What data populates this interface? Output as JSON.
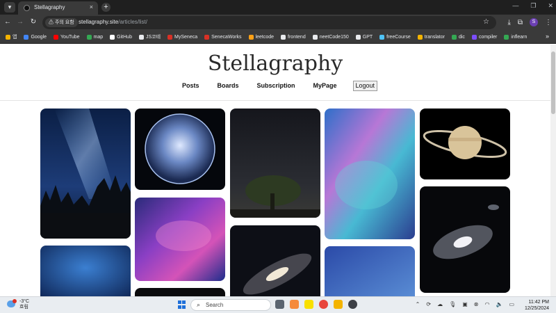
{
  "browser": {
    "tab_title": "Stellagraphy",
    "tab_close": "×",
    "new_tab": "+",
    "security_chip": "주의 요함",
    "url_host": "stellagraphy.site",
    "url_path": "/articles/list/",
    "profile_initial": "S",
    "bookmarks": [
      {
        "label": "앱",
        "icon": "apps-grid-icon",
        "color": "#f4b400"
      },
      {
        "label": "Google",
        "icon": "google-icon",
        "color": "#4285f4"
      },
      {
        "label": "YouTube",
        "icon": "youtube-icon",
        "color": "#ff0000"
      },
      {
        "label": "map",
        "icon": "map-icon",
        "color": "#34a853"
      },
      {
        "label": "GitHub",
        "icon": "github-icon",
        "color": "#ffffff"
      },
      {
        "label": "JS코테",
        "icon": "triangle-icon",
        "color": "#e8eaed"
      },
      {
        "label": "MySeneca",
        "icon": "seneca-icon",
        "color": "#d93025"
      },
      {
        "label": "SenecaWorks",
        "icon": "seneca-works-icon",
        "color": "#d93025"
      },
      {
        "label": "leetcode",
        "icon": "leetcode-icon",
        "color": "#ffa116"
      },
      {
        "label": "frontend",
        "icon": "code-icon",
        "color": "#e8eaed"
      },
      {
        "label": "neetCode150",
        "icon": "rocket-icon",
        "color": "#e8eaed"
      },
      {
        "label": "GPT",
        "icon": "openai-icon",
        "color": "#e8eaed"
      },
      {
        "label": "freeCourse",
        "icon": "course-icon",
        "color": "#4fc3f7"
      },
      {
        "label": "translator",
        "icon": "folder-icon",
        "color": "#f4b400"
      },
      {
        "label": "dic",
        "icon": "folder-icon",
        "color": "#34a853"
      },
      {
        "label": "compiler",
        "icon": "bolt-icon",
        "color": "#7c4dff"
      },
      {
        "label": "inflearn",
        "icon": "inflearn-icon",
        "color": "#34a853"
      }
    ]
  },
  "site": {
    "title": "Stellagraphy",
    "nav": {
      "posts": "Posts",
      "boards": "Boards",
      "subscription": "Subscription",
      "mypage": "MyPage",
      "logout": "Logout"
    }
  },
  "gallery": [
    {
      "name": "milky-way-forest-photo",
      "image": "Milky Way over pine forest silhouette"
    },
    {
      "name": "crystal-star-sphere-photo",
      "image": "Glowing crystal sphere of stars"
    },
    {
      "name": "colorful-nebula-photo",
      "image": "Purple and blue nebula"
    },
    {
      "name": "night-tree-starry-sky-photo",
      "image": "Tree under starry night sky"
    },
    {
      "name": "andromeda-galaxy-photo",
      "image": "Andromeda galaxy"
    },
    {
      "name": "cosmic-cloud-nebula-photo",
      "image": "Cyan and pink cosmic clouds"
    },
    {
      "name": "blue-star-field-photo",
      "image": "Blue star field"
    },
    {
      "name": "saturn-planet-photo",
      "image": "Saturn with rings"
    },
    {
      "name": "spiral-galaxy-photo",
      "image": "Spiral galaxy with stars"
    }
  ],
  "taskbar": {
    "notification_count": "1",
    "weather_temp": "-3°C",
    "weather_desc": "흐림",
    "search_placeholder": "Search",
    "time": "11:42 PM",
    "date": "12/25/2024"
  },
  "colors": {
    "chrome_dark": "#1f1f1f",
    "toolbar": "#3a3a3a",
    "page_bg": "#ffffff",
    "title_text": "#2a2a2a"
  }
}
